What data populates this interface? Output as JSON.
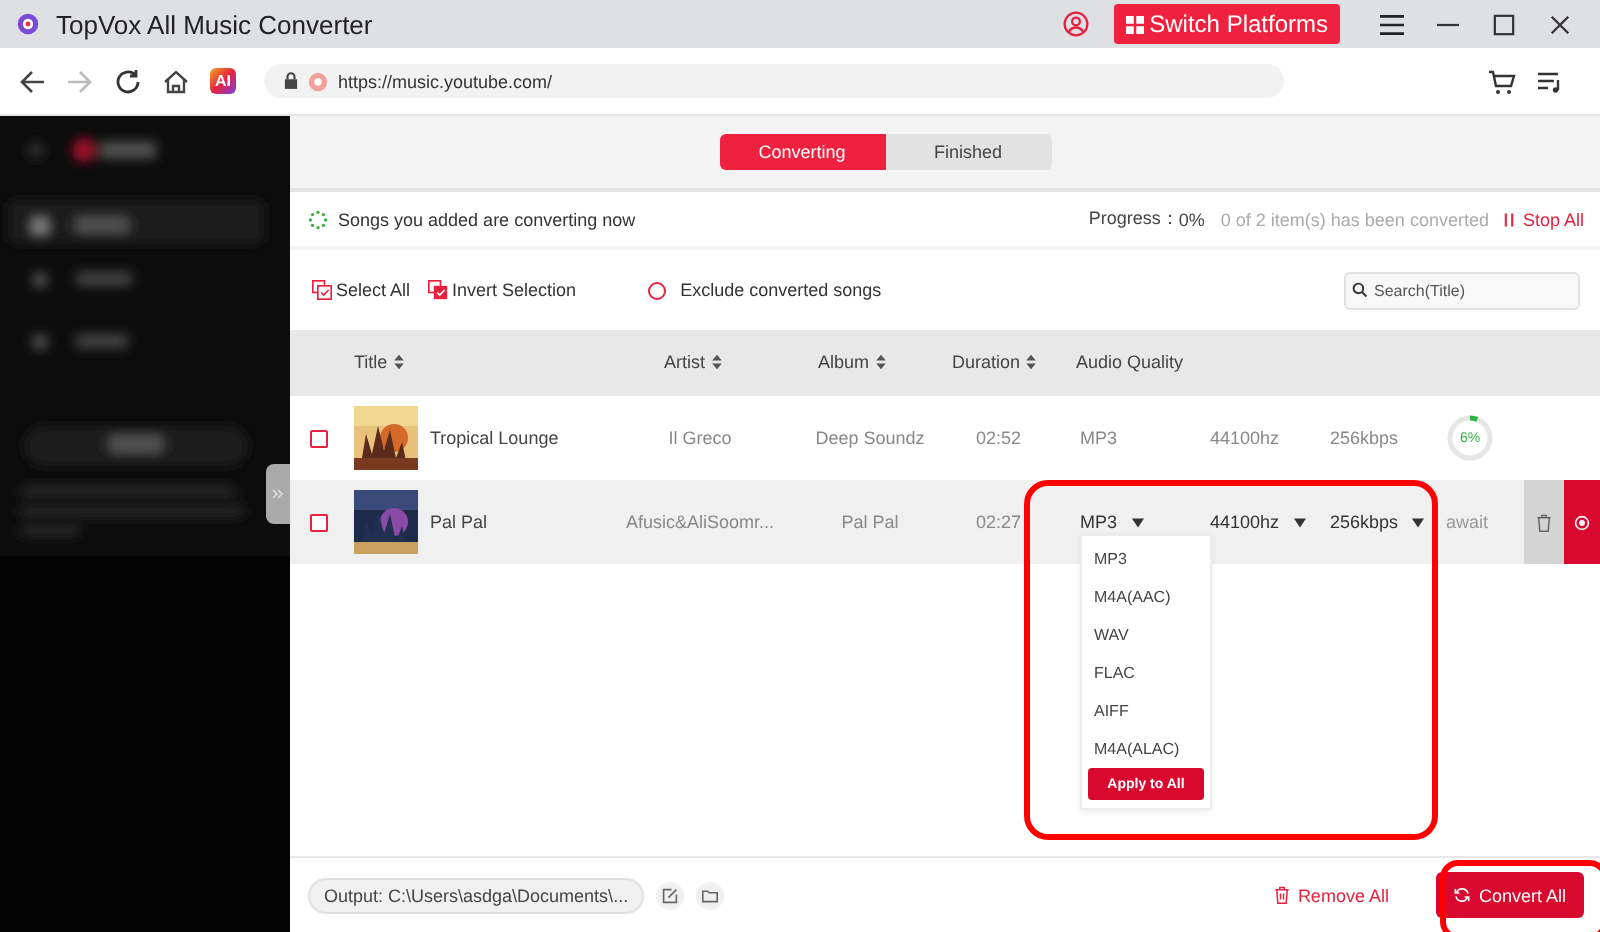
{
  "window": {
    "title": "TopVox All Music Converter",
    "switch_button": "Switch Platforms"
  },
  "browser": {
    "back_disabled": false,
    "forward_disabled": true,
    "ai_badge": "AI",
    "url": "https://music.youtube.com/"
  },
  "tabs": [
    {
      "label": "Converting",
      "selected": true
    },
    {
      "label": "Finished",
      "selected": false
    }
  ],
  "status": {
    "message": "Songs you added are converting now",
    "progress_label": "Progress：",
    "progress_value": "0%",
    "progress_detail": "0 of 2 item(s) has been converted",
    "stop_button": "Stop All"
  },
  "toolbar": {
    "select_all": "Select All",
    "invert_selection": "Invert Selection",
    "exclude_label": "Exclude converted songs",
    "exclude_checked": false,
    "search": {
      "placeholder": "Search(Title)"
    }
  },
  "table": {
    "columns": [
      {
        "label": "Title",
        "sortable": true
      },
      {
        "label": "Artist",
        "sortable": true
      },
      {
        "label": "Album",
        "sortable": true
      },
      {
        "label": "Duration",
        "sortable": true
      },
      {
        "label": "Audio Quality",
        "sortable": false
      }
    ],
    "rows": [
      {
        "checked": false,
        "highlighted": false,
        "title": "Tropical Lounge",
        "artist": "Il Greco",
        "album": "Deep Soundz",
        "duration": "02:52",
        "format": "MP3",
        "sample_rate": "44100hz",
        "bitrate": "256kbps",
        "editable": false,
        "status": {
          "kind": "progress",
          "level": 0.06,
          "text": "6%"
        }
      },
      {
        "checked": false,
        "highlighted": true,
        "title": "Pal Pal",
        "artist": "Afusic&AliSoomr...",
        "album": "Pal Pal",
        "duration": "02:27",
        "format": "MP3",
        "sample_rate": "44100hz",
        "bitrate": "256kbps",
        "editable": true,
        "status": {
          "kind": "waiting",
          "text": "await"
        }
      }
    ]
  },
  "format_menu": {
    "options": [
      "MP3",
      "M4A(AAC)",
      "WAV",
      "FLAC",
      "AIFF",
      "M4A(ALAC)"
    ],
    "apply_button": "Apply to All"
  },
  "footer": {
    "output": "Output: C:\\Users\\asdga\\Documents\\...",
    "remove_all": "Remove All",
    "convert_all": "Convert All"
  }
}
